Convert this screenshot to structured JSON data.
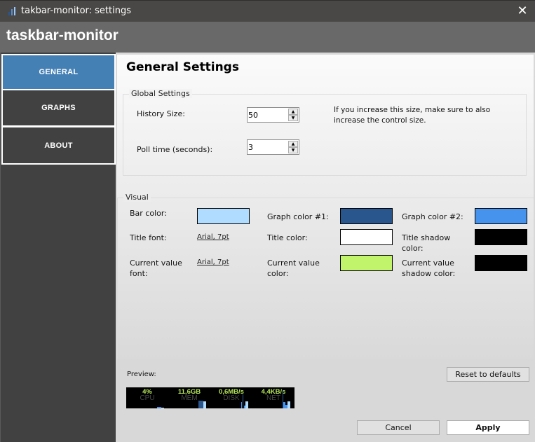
{
  "window": {
    "title": "takbar-monitor: settings",
    "close_icon": "close-icon",
    "app_icon": "bar-chart-icon"
  },
  "header": {
    "brand": "taskbar-monitor"
  },
  "sidebar": {
    "items": [
      {
        "label": "GENERAL",
        "active": true
      },
      {
        "label": "GRAPHS",
        "active": false
      },
      {
        "label": "ABOUT",
        "active": false
      }
    ]
  },
  "page": {
    "title": "General Settings",
    "global": {
      "legend": "Global Settings",
      "history_label": "History Size:",
      "history_value": "50",
      "poll_label": "Poll time (seconds):",
      "poll_value": "3",
      "hint": "If you increase this size, make sure to also increase the control size."
    },
    "visual": {
      "legend": "Visual",
      "bar_color_label": "Bar color:",
      "bar_color": "#b0dcff",
      "graph1_label": "Graph color #1:",
      "graph1_color": "#2a568e",
      "graph2_label": "Graph color #2:",
      "graph2_color": "#4693ed",
      "title_font_label": "Title font:",
      "title_font_value": "Arial, 7pt",
      "title_color_label": "Title color:",
      "title_color": "#ffffff",
      "title_shadow_label": "Title shadow color:",
      "title_shadow_color": "#000000",
      "cv_font_label": "Current value font:",
      "cv_font_value": "Arial, 7pt",
      "cv_color_label": "Current value color:",
      "cv_color": "#c2f46b",
      "cv_shadow_label": "Current value shadow color:",
      "cv_shadow_color": "#000000"
    }
  },
  "preview": {
    "label": "Preview:",
    "counters": [
      {
        "value": "4%",
        "title": "CPU"
      },
      {
        "value": "11,6GB",
        "title": "MEM"
      },
      {
        "value": "0,6MB/s",
        "title": "DISK"
      },
      {
        "value": "4,4KB/s",
        "title": "NET"
      }
    ]
  },
  "buttons": {
    "reset": "Reset to defaults",
    "cancel": "Cancel",
    "apply": "Apply"
  }
}
